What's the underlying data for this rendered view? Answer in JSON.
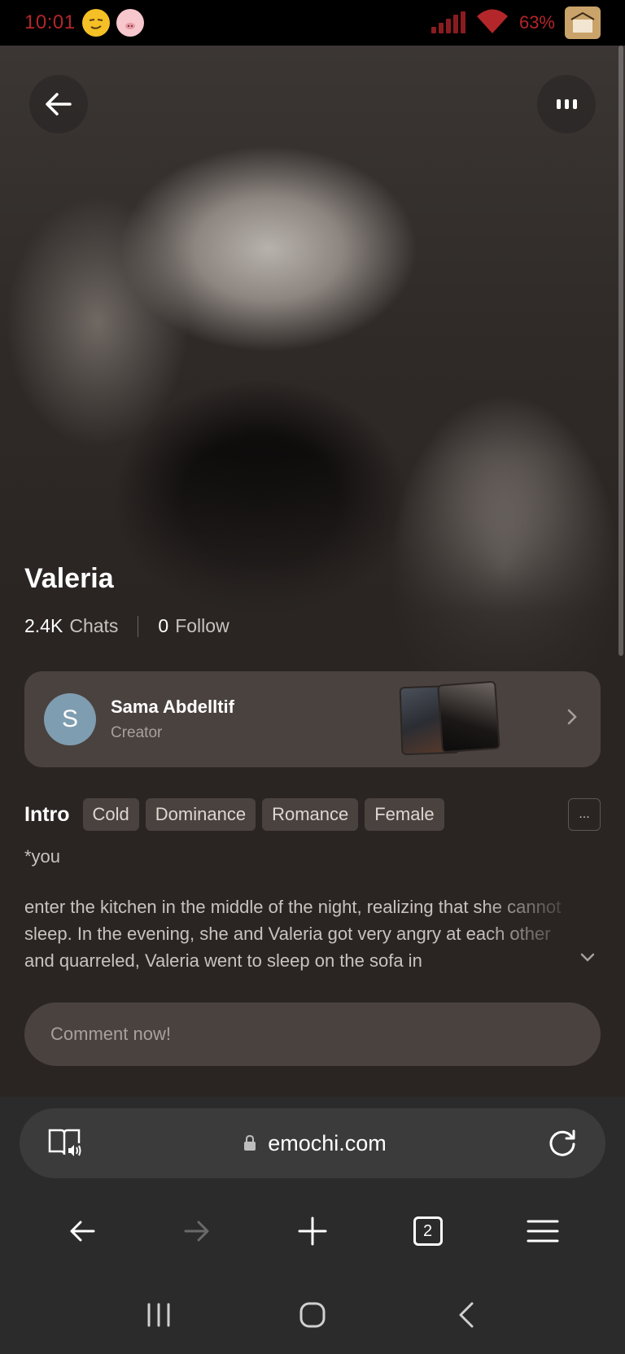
{
  "status_bar": {
    "time": "10:01",
    "battery": "63%",
    "colors": {
      "time": "#b3262a",
      "signal": "#8a1c20"
    },
    "icons": [
      "emoji-face-icon",
      "pig-icon",
      "signal-icon",
      "wifi-icon",
      "app-icon"
    ]
  },
  "profile": {
    "name": "Valeria",
    "chats_count": "2.4K",
    "chats_label": "Chats",
    "follow_count": "0",
    "follow_label": "Follow"
  },
  "creator": {
    "avatar_letter": "S",
    "name": "Sama Abdelltif",
    "role": "Creator",
    "avatar_color": "#7f9db0"
  },
  "intro": {
    "label": "Intro",
    "tags": [
      "Cold",
      "Dominance",
      "Romance",
      "Female"
    ],
    "more_label": "...",
    "line1": "*you",
    "body": "enter the kitchen in the middle of the night, realizing that she cannot sleep. In the evening, she and Valeria got very angry at each other and quarreled, Valeria went to sleep on the sofa in"
  },
  "comment": {
    "placeholder": "Comment now!"
  },
  "browser": {
    "url": "emochi.com",
    "tab_count": "2"
  }
}
